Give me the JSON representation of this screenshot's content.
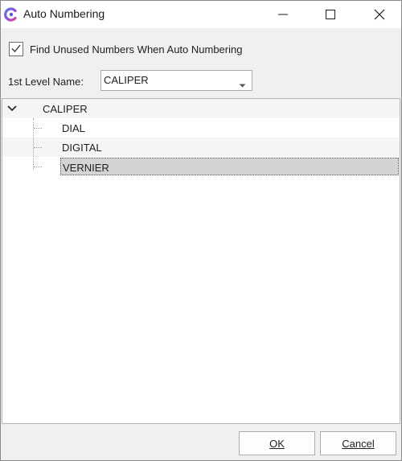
{
  "window": {
    "title": "Auto Numbering",
    "app_icon": "app-logo-icon",
    "controls": [
      "minimize-icon",
      "maximize-icon",
      "close-icon"
    ]
  },
  "options": {
    "find_unused_label": "Find Unused Numbers When Auto Numbering",
    "find_unused_checked": true
  },
  "level": {
    "label": "1st Level Name:",
    "selected": "CALIPER"
  },
  "tree": {
    "root": {
      "label": "CALIPER",
      "expanded": true
    },
    "children": [
      {
        "label": "DIAL"
      },
      {
        "label": "DIGITAL"
      },
      {
        "label": "VERNIER",
        "selected": true
      }
    ]
  },
  "buttons": {
    "ok": "OK",
    "cancel": "Cancel"
  },
  "colors": {
    "selection": "#d4d4d4",
    "accent_logo_a": "#5b5bd6",
    "accent_logo_b": "#e0409a"
  }
}
